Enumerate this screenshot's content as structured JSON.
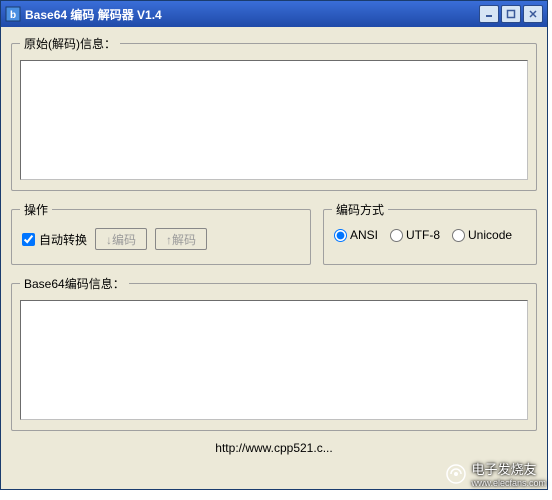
{
  "window": {
    "title": "Base64 编码 解码器 V1.4"
  },
  "groups": {
    "original_label": "原始(解码)信息：",
    "operation_label": "操作",
    "encoding_label": "编码方式",
    "base64_label": "Base64编码信息："
  },
  "inputs": {
    "original_value": "",
    "base64_value": ""
  },
  "operation": {
    "auto_convert_label": "自动转换",
    "auto_convert_checked": true,
    "encode_btn": "↓编码",
    "decode_btn": "↑解码"
  },
  "encoding": {
    "options": [
      {
        "label": "ANSI",
        "checked": true
      },
      {
        "label": "UTF-8",
        "checked": false
      },
      {
        "label": "Unicode",
        "checked": false
      }
    ]
  },
  "footer": {
    "url": "http://www.cpp521.c..."
  },
  "watermark": {
    "text": "电子发烧友",
    "site": "www.elecfans.com"
  }
}
